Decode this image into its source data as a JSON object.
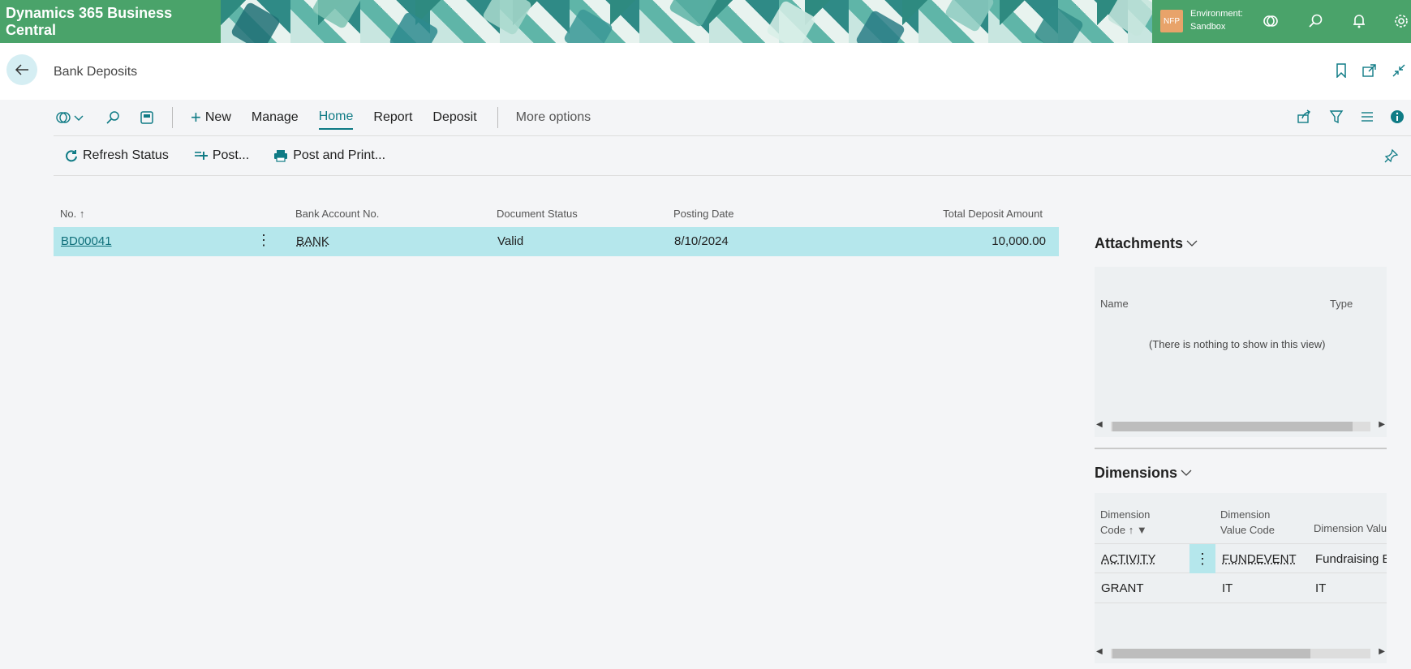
{
  "app": {
    "title": "Dynamics 365 Business Central",
    "avatar_initials": "NFP",
    "env_line1": "Environment:",
    "env_line2": "Sandbox"
  },
  "page": {
    "title": "Bank Deposits"
  },
  "actions": {
    "new": "New",
    "manage": "Manage",
    "home": "Home",
    "report": "Report",
    "deposit": "Deposit",
    "more": "More options",
    "refresh": "Refresh Status",
    "post": "Post...",
    "post_print": "Post and Print..."
  },
  "list": {
    "columns": [
      "No. ↑",
      "Bank Account No.",
      "Document Status",
      "Posting Date",
      "Total Deposit Amount"
    ],
    "rows": [
      {
        "no": "BD00041",
        "bank": "BANK",
        "status": "Valid",
        "date": "8/10/2024",
        "amount": "10,000.00"
      }
    ]
  },
  "attachments": {
    "title": "Attachments",
    "col_name": "Name",
    "col_type": "Type",
    "empty": "(There is nothing to show in this view)"
  },
  "dimensions": {
    "title": "Dimensions",
    "col1a": "Dimension",
    "col1b": "Code ↑",
    "col2a": "Dimension",
    "col2b": "Value Code",
    "col3": "Dimension Valu",
    "rows": [
      {
        "code": "ACTIVITY",
        "value": "FUNDEVENT",
        "name": "Fundraising E"
      },
      {
        "code": "GRANT",
        "value": "IT",
        "name": "IT"
      }
    ]
  },
  "colors": {
    "accent": "#0f7b85",
    "selected_row": "#b5e7ec",
    "banner": "#4aa36a"
  }
}
